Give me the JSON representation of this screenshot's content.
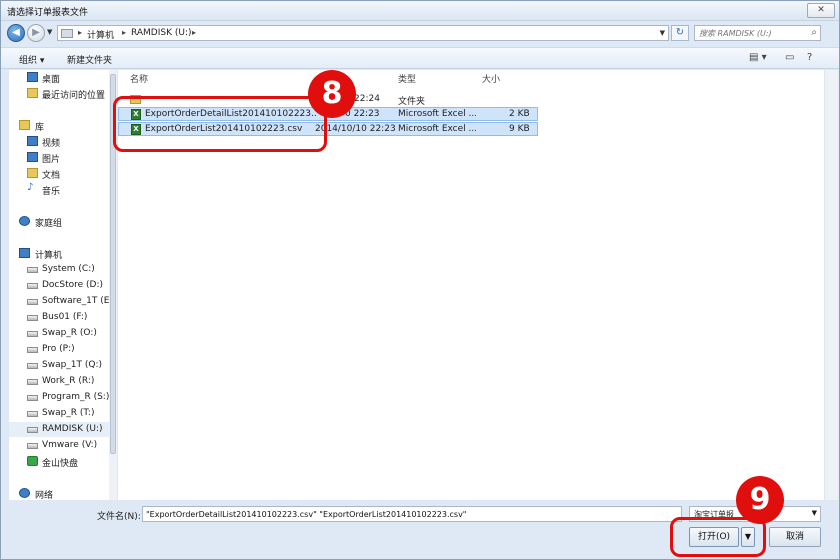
{
  "window": {
    "title": "请选择订单报表文件",
    "close_label": "✕"
  },
  "nav": {
    "breadcrumb": [
      "计算机",
      "RAMDISK (U:)"
    ],
    "search_placeholder": "搜索 RAMDISK (U:)"
  },
  "toolbar": {
    "organize": "组织 ▾",
    "new_folder": "新建文件夹"
  },
  "sidebar": {
    "items": [
      {
        "label": "桌面",
        "icon": "desktop-icon"
      },
      {
        "label": "最近访问的位置",
        "icon": "recent-places-icon"
      },
      {
        "label": "库",
        "icon": "library-icon"
      },
      {
        "label": "视频",
        "icon": "video-icon"
      },
      {
        "label": "图片",
        "icon": "pictures-icon"
      },
      {
        "label": "文档",
        "icon": "documents-icon"
      },
      {
        "label": "音乐",
        "icon": "music-icon"
      },
      {
        "label": "家庭组",
        "icon": "homegroup-icon"
      },
      {
        "label": "计算机",
        "icon": "computer-icon"
      },
      {
        "label": "System (C:)",
        "icon": "drive-icon"
      },
      {
        "label": "DocStore (D:)",
        "icon": "drive-icon"
      },
      {
        "label": "Software_1T (E:",
        "icon": "drive-icon"
      },
      {
        "label": "Bus01 (F:)",
        "icon": "drive-icon"
      },
      {
        "label": "Swap_R (O:)",
        "icon": "drive-icon"
      },
      {
        "label": "Pro (P:)",
        "icon": "drive-icon"
      },
      {
        "label": "Swap_1T (Q:)",
        "icon": "drive-icon"
      },
      {
        "label": "Work_R (R:)",
        "icon": "drive-icon"
      },
      {
        "label": "Program_R (S:)",
        "icon": "drive-icon"
      },
      {
        "label": "Swap_R (T:)",
        "icon": "drive-icon"
      },
      {
        "label": "RAMDISK (U:)",
        "icon": "drive-icon"
      },
      {
        "label": "Vmware (V:)",
        "icon": "drive-icon"
      },
      {
        "label": "金山快盘",
        "icon": "kuaipan-icon"
      },
      {
        "label": "网络",
        "icon": "network-icon"
      }
    ]
  },
  "columns": {
    "name": "名称",
    "type": "类型",
    "size": "大小"
  },
  "files": [
    {
      "name": "",
      "date": "22:24",
      "type": "文件夹",
      "size": ""
    },
    {
      "name": "ExportOrderDetailList201410102223....",
      "date": "0 22:23",
      "type": "Microsoft Excel ...",
      "size": "2 KB"
    },
    {
      "name": "ExportOrderList201410102223.csv",
      "date": "2014/10/10 22:23",
      "type": "Microsoft Excel ...",
      "size": "9 KB"
    }
  ],
  "footer": {
    "filename_label": "文件名(N):",
    "filename_value": "\"ExportOrderDetailList201410102223.csv\" \"ExportOrderList201410102223.csv\"",
    "filter_value": "淘宝订单报",
    "open_label": "打开(O)",
    "cancel_label": "取消"
  },
  "annotations": {
    "step_a": "8",
    "step_b": "9",
    "color": "#e10e0e"
  }
}
